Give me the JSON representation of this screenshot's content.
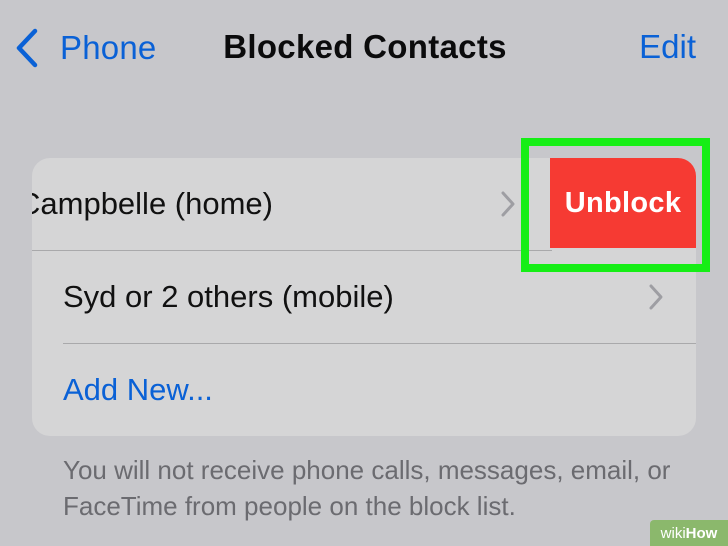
{
  "nav": {
    "back_label": "Phone",
    "title": "Blocked Contacts",
    "edit_label": "Edit"
  },
  "contacts": [
    {
      "label": "Campbelle (home)"
    },
    {
      "label": "Syd or 2 others (mobile)"
    }
  ],
  "add_new_label": "Add New...",
  "swipe_action": {
    "label": "Unblock",
    "color": "#f63a33",
    "highlight_color": "#16ee16"
  },
  "footer_note": "You will not receive phone calls, messages, email, or FaceTime from people on the block list.",
  "watermark": {
    "prefix": "wiki",
    "suffix": "How"
  },
  "colors": {
    "accent": "#0a61d6",
    "background": "#c7c7cb",
    "card": "#d5d5d6"
  }
}
